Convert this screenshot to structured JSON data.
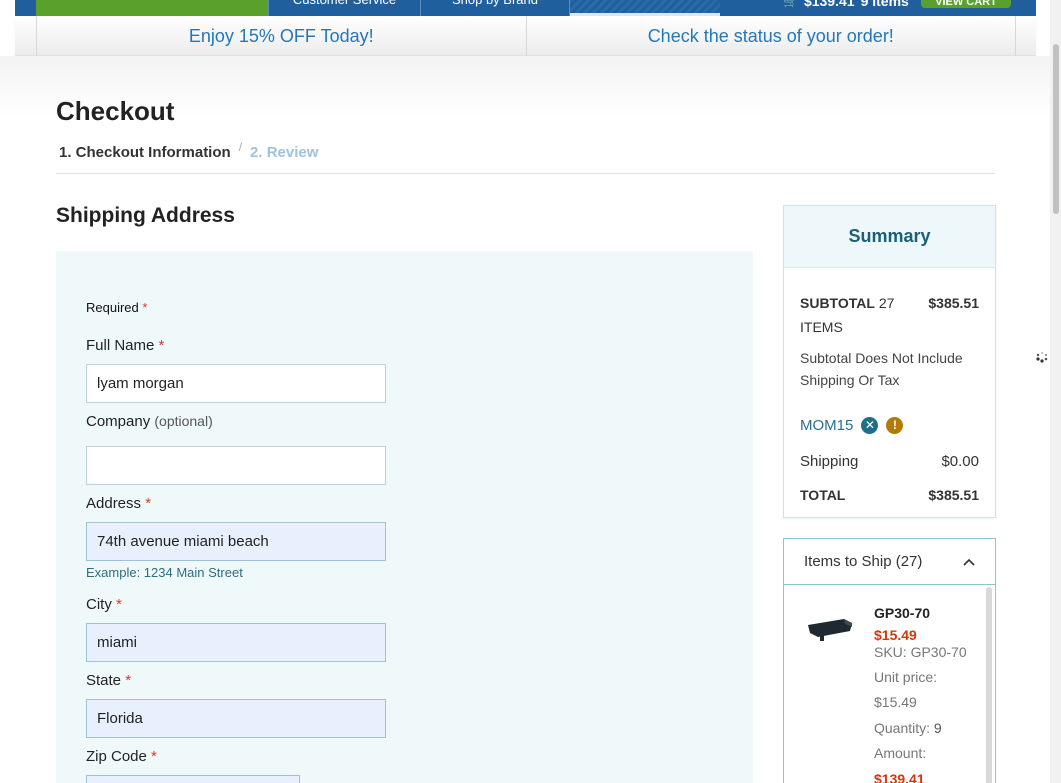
{
  "header": {
    "nav_service": "Customer Service",
    "nav_brand": "Shop by Brand",
    "cart_total": "$139.41",
    "cart_items": "9 items",
    "view_cart": "VIEW CART"
  },
  "promo": {
    "left": "Enjoy 15% OFF Today!",
    "right": "Check the status of your order!"
  },
  "checkout": {
    "title": "Checkout",
    "step1": "1. Checkout Information",
    "step_sep": "/",
    "step2": "2. Review"
  },
  "shipping": {
    "title": "Shipping Address",
    "required_note": "Required",
    "required_mark": "*",
    "fields": {
      "full_name": {
        "label": "Full Name",
        "value": "lyam morgan"
      },
      "company": {
        "label": "Company",
        "optional": "(optional)",
        "value": ""
      },
      "address": {
        "label": "Address",
        "value": "74th avenue miami beach",
        "hint": "Example: 1234 Main Street"
      },
      "city": {
        "label": "City",
        "value": "miami"
      },
      "state": {
        "label": "State",
        "value": "Florida"
      },
      "zip": {
        "label": "Zip Code",
        "value": ""
      }
    }
  },
  "summary": {
    "title": "Summary",
    "subtotal_label": "SUBTOTAL",
    "subtotal_count": "27 ITEMS",
    "subtotal_value": "$385.51",
    "note": "Subtotal Does Not Include Shipping Or Tax",
    "coupon": "MOM15",
    "shipping_label": "Shipping",
    "shipping_value": "$0.00",
    "total_label": "TOTAL",
    "total_value": "$385.51"
  },
  "items": {
    "header": "Items to Ship (27)",
    "list": [
      {
        "name": "GP30-70",
        "price": "$15.49",
        "sku": "SKU: GP30-70",
        "unit_label": "Unit price:",
        "unit_value": "$15.49",
        "qty_label": "Quantity:",
        "qty_value": "9",
        "amount_label": "Amount:",
        "amount_value": "$139.41"
      }
    ]
  },
  "colors": {
    "brand_blue": "#1f5f9e",
    "accent_green": "#5aa02c",
    "link_blue": "#2478b8",
    "price_red": "#d4380d"
  }
}
